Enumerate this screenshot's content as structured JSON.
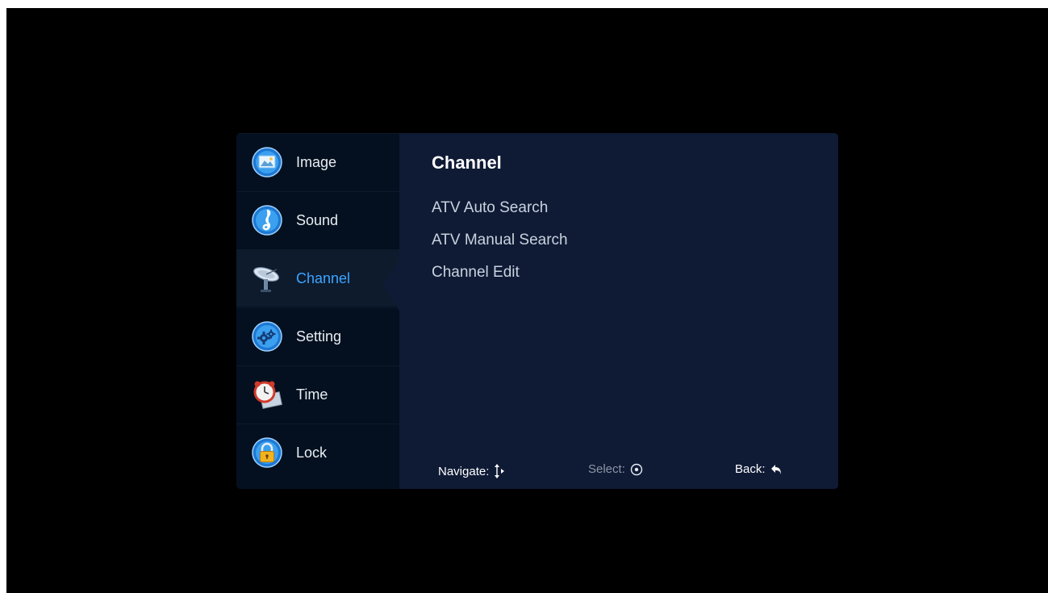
{
  "sidebar": {
    "items": [
      {
        "label": "Image",
        "icon": "image-icon",
        "active": false
      },
      {
        "label": "Sound",
        "icon": "music-note-icon",
        "active": false
      },
      {
        "label": "Channel",
        "icon": "satellite-dish-icon",
        "active": true
      },
      {
        "label": "Setting",
        "icon": "gear-icon",
        "active": false
      },
      {
        "label": "Time",
        "icon": "alarm-clock-icon",
        "active": false
      },
      {
        "label": "Lock",
        "icon": "padlock-icon",
        "active": false
      }
    ]
  },
  "content": {
    "title": "Channel",
    "items": [
      "ATV Auto Search",
      "ATV Manual Search",
      "Channel Edit"
    ]
  },
  "footer": {
    "navigate_label": "Navigate:",
    "select_label": "Select:",
    "back_label": "Back:"
  },
  "colors": {
    "active_label": "#3da4ff",
    "panel_background": "#0f1b35",
    "sidebar_background": "#04101f"
  }
}
